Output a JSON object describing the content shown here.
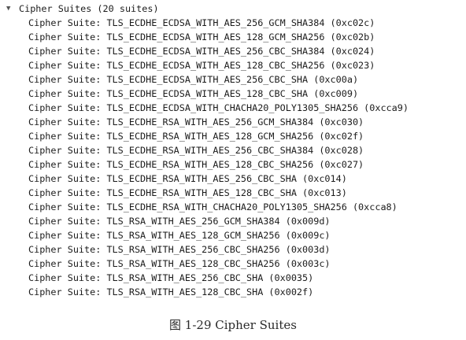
{
  "tree": {
    "expand_glyph": "▼",
    "expand_icon": "triangle-down-icon",
    "header_label": "Cipher Suites (20 suites)",
    "row_prefix": "Cipher Suite: ",
    "suites": [
      "TLS_ECDHE_ECDSA_WITH_AES_256_GCM_SHA384 (0xc02c)",
      "TLS_ECDHE_ECDSA_WITH_AES_128_GCM_SHA256 (0xc02b)",
      "TLS_ECDHE_ECDSA_WITH_AES_256_CBC_SHA384 (0xc024)",
      "TLS_ECDHE_ECDSA_WITH_AES_128_CBC_SHA256 (0xc023)",
      "TLS_ECDHE_ECDSA_WITH_AES_256_CBC_SHA (0xc00a)",
      "TLS_ECDHE_ECDSA_WITH_AES_128_CBC_SHA (0xc009)",
      "TLS_ECDHE_ECDSA_WITH_CHACHA20_POLY1305_SHA256 (0xcca9)",
      "TLS_ECDHE_RSA_WITH_AES_256_GCM_SHA384 (0xc030)",
      "TLS_ECDHE_RSA_WITH_AES_128_GCM_SHA256 (0xc02f)",
      "TLS_ECDHE_RSA_WITH_AES_256_CBC_SHA384 (0xc028)",
      "TLS_ECDHE_RSA_WITH_AES_128_CBC_SHA256 (0xc027)",
      "TLS_ECDHE_RSA_WITH_AES_256_CBC_SHA (0xc014)",
      "TLS_ECDHE_RSA_WITH_AES_128_CBC_SHA (0xc013)",
      "TLS_ECDHE_RSA_WITH_CHACHA20_POLY1305_SHA256 (0xcca8)",
      "TLS_RSA_WITH_AES_256_GCM_SHA384 (0x009d)",
      "TLS_RSA_WITH_AES_128_GCM_SHA256 (0x009c)",
      "TLS_RSA_WITH_AES_256_CBC_SHA256 (0x003d)",
      "TLS_RSA_WITH_AES_128_CBC_SHA256 (0x003c)",
      "TLS_RSA_WITH_AES_256_CBC_SHA (0x0035)",
      "TLS_RSA_WITH_AES_128_CBC_SHA (0x002f)"
    ]
  },
  "caption": "图 1-29 Cipher Suites"
}
